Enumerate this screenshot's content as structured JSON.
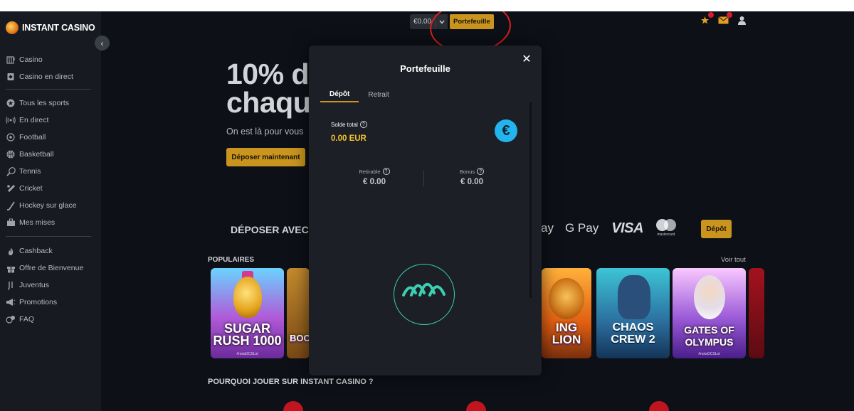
{
  "brand": {
    "name": "INSTANT CASINO"
  },
  "sidebar": {
    "collapse_icon": "‹",
    "group1": [
      {
        "label": "Casino",
        "icon": "slot-icon"
      },
      {
        "label": "Casino en direct",
        "icon": "cards-icon"
      }
    ],
    "group2": [
      {
        "label": "Tous les sports",
        "icon": "star-icon"
      },
      {
        "label": "En direct",
        "icon": "broadcast-icon"
      },
      {
        "label": "Football",
        "icon": "football-icon"
      },
      {
        "label": "Basketball",
        "icon": "basketball-icon"
      },
      {
        "label": "Tennis",
        "icon": "tennis-icon"
      },
      {
        "label": "Cricket",
        "icon": "cricket-icon"
      },
      {
        "label": "Hockey sur glace",
        "icon": "hockey-icon"
      },
      {
        "label": "Mes mises",
        "icon": "briefcase-icon"
      }
    ],
    "group3": [
      {
        "label": "Cashback",
        "icon": "flame-icon"
      },
      {
        "label": "Offre de Bienvenue",
        "icon": "gift-icon"
      },
      {
        "label": "Juventus",
        "icon": "juventus-icon"
      },
      {
        "label": "Promotions",
        "icon": "megaphone-icon"
      },
      {
        "label": "FAQ",
        "icon": "faq-icon"
      }
    ]
  },
  "topbar": {
    "balance": "€0.00",
    "wallet_button": "Portefeuille",
    "icons": [
      "star-icon",
      "mail-icon",
      "user-icon"
    ]
  },
  "hero": {
    "title_line1": "10% d",
    "title_line2": "chaqu",
    "subtitle": "On est là pour vous",
    "cta": "Déposer maintenant"
  },
  "deposit_with": {
    "heading": "DÉPOSER AVEC",
    "methods": [
      "ay",
      "G Pay",
      "VISA",
      "mastercard"
    ],
    "button": "Dépôt"
  },
  "popular": {
    "heading": "POPULAIRES",
    "see_all": "Voir tout",
    "games": [
      {
        "title": "SUGAR RUSH 1000",
        "sub": "#notaGCSLot"
      },
      {
        "title": "BOO",
        "sub": ""
      },
      {
        "title": "ING LION",
        "sub": ""
      },
      {
        "title": "CHAOS CREW 2",
        "sub": ""
      },
      {
        "title": "GATES OF OLYMPUS",
        "sub": "#notaGCSLot"
      }
    ]
  },
  "why": {
    "heading": "POURQUOI JOUER SUR INSTANT CASINO ?"
  },
  "modal": {
    "title": "Portefeuille",
    "close_icon": "✕",
    "tabs": [
      "Dépôt",
      "Retrait"
    ],
    "active_tab": "Dépôt",
    "total_label": "Solde total",
    "total_value": "0.00 EUR",
    "currency_symbol": "€",
    "withdrawable_label": "Retirable",
    "withdrawable_value": "€ 0.00",
    "bonus_label": "Bonus",
    "bonus_value": "€ 0.00",
    "info_glyph": "?"
  },
  "colors": {
    "accent": "#c9951f",
    "balance_highlight": "#f2c12e",
    "currency_badge": "#23b4ee",
    "loader": "#3ccfb1",
    "annotation": "#e0201b",
    "notification": "#d81b2f"
  }
}
